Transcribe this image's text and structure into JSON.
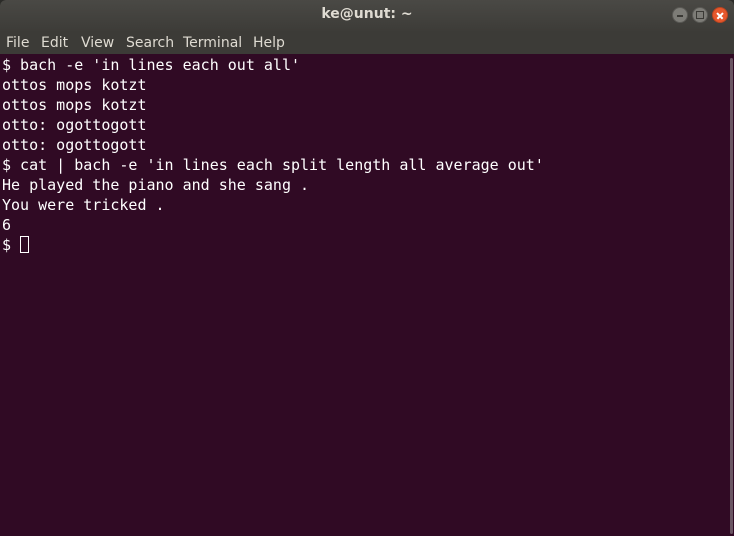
{
  "window": {
    "title": "ke@unut: ~",
    "controls": {
      "minimize": "minimize-icon",
      "maximize": "maximize-icon",
      "close": "close-icon"
    }
  },
  "menu": {
    "items": [
      "File",
      "Edit",
      "View",
      "Search",
      "Terminal",
      "Help"
    ]
  },
  "terminal": {
    "lines": [
      "$ bach -e 'in lines each out all'",
      "ottos mops kotzt",
      "ottos mops kotzt",
      "otto: ogottogott",
      "otto: ogottogott",
      "$ cat | bach -e 'in lines each split length all average out'",
      "He played the piano and she sang .",
      "You were tricked .",
      "6"
    ],
    "prompt": "$"
  },
  "colors": {
    "terminal_bg": "#300a24",
    "terminal_fg": "#ffffff",
    "titlebar_bg": "#3d3c38",
    "close_button": "#e6572c"
  }
}
